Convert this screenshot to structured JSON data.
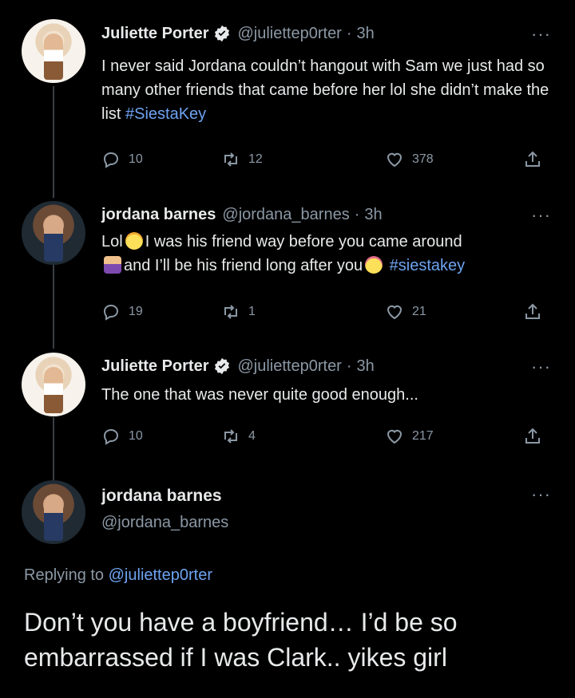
{
  "tweets": [
    {
      "name": "Juliette Porter",
      "handle": "@juliettep0rter",
      "time": "3h",
      "text": "I never said Jordana couldn’t hangout with Sam we just had so many other friends that came before her lol she didn’t make the list ",
      "hashtag": "#SiestaKey",
      "replies": "10",
      "retweets": "12",
      "likes": "378"
    },
    {
      "name": "jordana barnes",
      "handle": "@jordana_barnes",
      "time": "3h",
      "text_a": "Lol",
      "text_b": "I was his friend way before you came around",
      "text_c": "and I’ll be his friend long after you",
      "hashtag": "#siestakey",
      "replies": "19",
      "retweets": "1",
      "likes": "21"
    },
    {
      "name": "Juliette Porter",
      "handle": "@juliettep0rter",
      "time": "3h",
      "text": "The one that was never quite good enough...",
      "replies": "10",
      "retweets": "4",
      "likes": "217"
    }
  ],
  "main_tweet": {
    "name": "jordana barnes",
    "handle": "@jordana_barnes",
    "replying_prefix": "Replying to",
    "replying_to": "@juliettep0rter",
    "text": "Don’t you have a boyfriend… I’d be so embarrassed if I was Clark.. yikes girl"
  },
  "separator": "·",
  "more_glyph": "···",
  "colors": {
    "background": "#000000",
    "text": "#e7e9ea",
    "muted": "#8b98a5",
    "link": "#6ea3f0",
    "verified": "#e7e9ea"
  },
  "icons": [
    "reply-icon",
    "retweet-icon",
    "like-icon",
    "share-icon",
    "verified-icon",
    "more-icon"
  ]
}
